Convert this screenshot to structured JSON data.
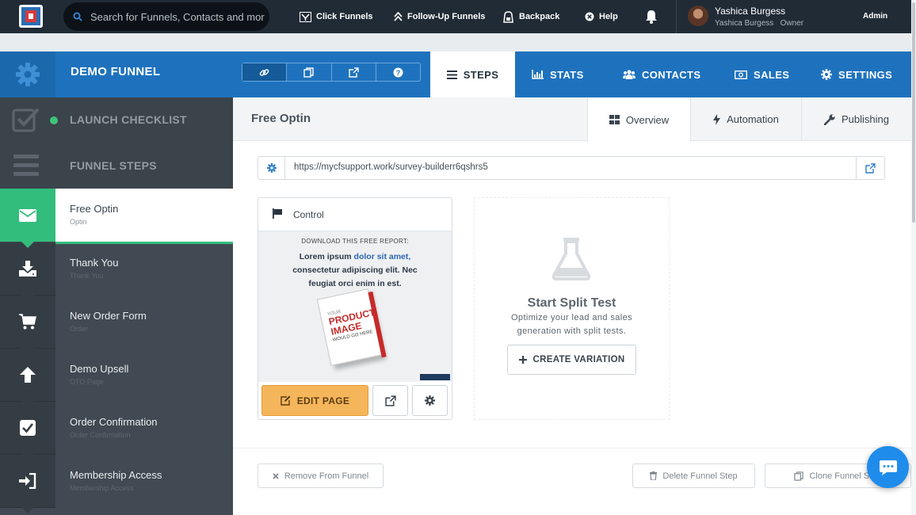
{
  "topbar": {
    "search_placeholder": "Search for Funnels, Contacts and more",
    "nav": [
      {
        "label": "Click Funnels",
        "icon": "clickfunnels-icon"
      },
      {
        "label": "Follow-Up Funnels",
        "icon": "follow-up-icon"
      },
      {
        "label": "Backpack",
        "icon": "backpack-icon"
      },
      {
        "label": "Help",
        "icon": "help-icon"
      }
    ],
    "user": {
      "name": "Yashica Burgess",
      "sub": "Yashica Burgess   Owner",
      "role": "Admin"
    }
  },
  "funnel": {
    "name": "DEMO FUNNEL",
    "tabs": [
      {
        "label": "STEPS",
        "active": true
      },
      {
        "label": "STATS"
      },
      {
        "label": "CONTACTS"
      },
      {
        "label": "SALES"
      },
      {
        "label": "SETTINGS"
      }
    ]
  },
  "sidebar": {
    "checklist": "LAUNCH CHECKLIST",
    "funnel_steps": "FUNNEL STEPS",
    "steps": [
      {
        "title": "Free Optin",
        "sub": "Optin"
      },
      {
        "title": "Thank You",
        "sub": "Thank You"
      },
      {
        "title": "New Order Form",
        "sub": "Order"
      },
      {
        "title": "Demo Upsell",
        "sub": "OTO Page"
      },
      {
        "title": "Order Confirmation",
        "sub": "Order Confirmation"
      },
      {
        "title": "Membership Access",
        "sub": "Membership Access"
      }
    ]
  },
  "step": {
    "title": "Free Optin",
    "tabs": [
      {
        "label": "Overview",
        "active": true
      },
      {
        "label": "Automation"
      },
      {
        "label": "Publishing"
      }
    ],
    "url": "https://mycfsupport.work/survey-builderr6qshrs5",
    "variant": {
      "label": "Control",
      "preview": {
        "kicker": "DOWNLOAD THIS FREE REPORT:",
        "line1a": "Lorem ipsum ",
        "line1b": "dolor sit amet,",
        "line2": "consectetur adipiscing elit. Nec",
        "line3": "feugiat orci enim in est.",
        "book_top": "YOUR",
        "book_main": "PRODUCT IMAGE",
        "book_bottom": "WOULD GO HERE"
      },
      "edit_label": "EDIT PAGE"
    },
    "split": {
      "title": "Start Split Test",
      "desc": "Optimize your lead and sales generation with split tests.",
      "button": "CREATE VARIATION"
    },
    "footer": {
      "remove": "Remove From Funnel",
      "delete": "Delete Funnel Step",
      "clone": "Clone Funnel Step"
    }
  },
  "colors": {
    "topbar": "#212b36",
    "brand_blue": "#1e72bd",
    "sidebar": "#414a52",
    "active_green": "#33bd7c",
    "edit_orange": "#f5b55a",
    "chat_blue": "#1f8ceb"
  }
}
